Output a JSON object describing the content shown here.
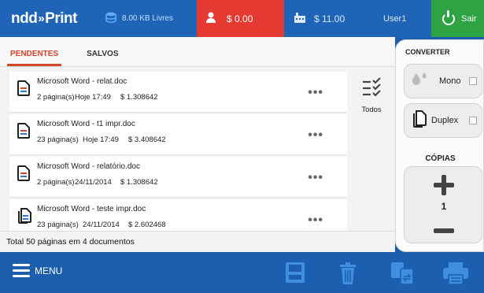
{
  "header": {
    "logo_left": "ndd",
    "logo_arrow": "»",
    "logo_right": "Print",
    "storage_label": "8.00 KB Livres",
    "balance": "$ 0.00",
    "total": "$ 11.00",
    "user": "User1",
    "exit_label": "Sair"
  },
  "tabs": [
    {
      "label": "PENDENTES",
      "active": true
    },
    {
      "label": "SALVOS",
      "active": false
    }
  ],
  "documents": [
    {
      "title": "Microsoft Word - relat.doc",
      "pages": "2 página(s)",
      "date": "Hoje 17:49",
      "price": "$ 1.308642",
      "icon": "word-doc-icon"
    },
    {
      "title": "Microsoft Word - t1 impr.doc",
      "pages": "23 página(s)",
      "date": "Hoje 17:49",
      "price": "$ 3.408642",
      "icon": "word-doc-icon"
    },
    {
      "title": "Microsoft Word - relatório.doc",
      "pages": "2 página(s)",
      "date": "24/11/2014",
      "price": "$ 1.308642",
      "icon": "word-doc-icon"
    },
    {
      "title": "Microsoft Word - teste impr.doc",
      "pages": "23 página(s)",
      "date": "24/11/2014",
      "price": "$ 2.602468",
      "icon": "duplex-doc-icon"
    }
  ],
  "more_label": "•••",
  "select_all_label": "Todos",
  "total_summary": "Total 50 páginas em 4 documentos",
  "side": {
    "converter_label": "CONVERTER",
    "mono_label": "Mono",
    "duplex_label": "Duplex",
    "copies_label": "CÓPIAS",
    "copies_value": "1"
  },
  "bottombar": {
    "menu_label": "MENU",
    "icons": [
      "save-icon",
      "trash-icon",
      "convert-icon",
      "print-icon"
    ]
  },
  "colors": {
    "header_blue": "#1f64b6",
    "balance_red": "#e43a32",
    "exit_green": "#2ea344",
    "accent_tab": "#d2462a"
  }
}
